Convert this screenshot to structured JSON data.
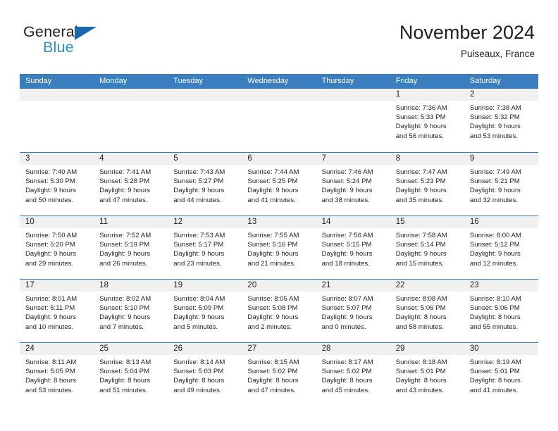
{
  "brand": {
    "name_top": "General",
    "name_bottom": "Blue",
    "accent_color": "#2b8fd6",
    "triangle_color": "#1b6ab0",
    "triangle_icon": "triangle-icon"
  },
  "header": {
    "title": "November 2024",
    "subtitle": "Puiseaux, France"
  },
  "calendar": {
    "header_bg": "#3a7ebf",
    "day_strip_bg": "#f0f0f0",
    "weekdays": [
      "Sunday",
      "Monday",
      "Tuesday",
      "Wednesday",
      "Thursday",
      "Friday",
      "Saturday"
    ],
    "weeks": [
      [
        {
          "date": "",
          "lines": []
        },
        {
          "date": "",
          "lines": []
        },
        {
          "date": "",
          "lines": []
        },
        {
          "date": "",
          "lines": []
        },
        {
          "date": "",
          "lines": []
        },
        {
          "date": "1",
          "lines": [
            "Sunrise: 7:36 AM",
            "Sunset: 5:33 PM",
            "Daylight: 9 hours",
            "and 56 minutes."
          ]
        },
        {
          "date": "2",
          "lines": [
            "Sunrise: 7:38 AM",
            "Sunset: 5:32 PM",
            "Daylight: 9 hours",
            "and 53 minutes."
          ]
        }
      ],
      [
        {
          "date": "3",
          "lines": [
            "Sunrise: 7:40 AM",
            "Sunset: 5:30 PM",
            "Daylight: 9 hours",
            "and 50 minutes."
          ]
        },
        {
          "date": "4",
          "lines": [
            "Sunrise: 7:41 AM",
            "Sunset: 5:28 PM",
            "Daylight: 9 hours",
            "and 47 minutes."
          ]
        },
        {
          "date": "5",
          "lines": [
            "Sunrise: 7:43 AM",
            "Sunset: 5:27 PM",
            "Daylight: 9 hours",
            "and 44 minutes."
          ]
        },
        {
          "date": "6",
          "lines": [
            "Sunrise: 7:44 AM",
            "Sunset: 5:25 PM",
            "Daylight: 9 hours",
            "and 41 minutes."
          ]
        },
        {
          "date": "7",
          "lines": [
            "Sunrise: 7:46 AM",
            "Sunset: 5:24 PM",
            "Daylight: 9 hours",
            "and 38 minutes."
          ]
        },
        {
          "date": "8",
          "lines": [
            "Sunrise: 7:47 AM",
            "Sunset: 5:23 PM",
            "Daylight: 9 hours",
            "and 35 minutes."
          ]
        },
        {
          "date": "9",
          "lines": [
            "Sunrise: 7:49 AM",
            "Sunset: 5:21 PM",
            "Daylight: 9 hours",
            "and 32 minutes."
          ]
        }
      ],
      [
        {
          "date": "10",
          "lines": [
            "Sunrise: 7:50 AM",
            "Sunset: 5:20 PM",
            "Daylight: 9 hours",
            "and 29 minutes."
          ]
        },
        {
          "date": "11",
          "lines": [
            "Sunrise: 7:52 AM",
            "Sunset: 5:19 PM",
            "Daylight: 9 hours",
            "and 26 minutes."
          ]
        },
        {
          "date": "12",
          "lines": [
            "Sunrise: 7:53 AM",
            "Sunset: 5:17 PM",
            "Daylight: 9 hours",
            "and 23 minutes."
          ]
        },
        {
          "date": "13",
          "lines": [
            "Sunrise: 7:55 AM",
            "Sunset: 5:16 PM",
            "Daylight: 9 hours",
            "and 21 minutes."
          ]
        },
        {
          "date": "14",
          "lines": [
            "Sunrise: 7:56 AM",
            "Sunset: 5:15 PM",
            "Daylight: 9 hours",
            "and 18 minutes."
          ]
        },
        {
          "date": "15",
          "lines": [
            "Sunrise: 7:58 AM",
            "Sunset: 5:14 PM",
            "Daylight: 9 hours",
            "and 15 minutes."
          ]
        },
        {
          "date": "16",
          "lines": [
            "Sunrise: 8:00 AM",
            "Sunset: 5:12 PM",
            "Daylight: 9 hours",
            "and 12 minutes."
          ]
        }
      ],
      [
        {
          "date": "17",
          "lines": [
            "Sunrise: 8:01 AM",
            "Sunset: 5:11 PM",
            "Daylight: 9 hours",
            "and 10 minutes."
          ]
        },
        {
          "date": "18",
          "lines": [
            "Sunrise: 8:02 AM",
            "Sunset: 5:10 PM",
            "Daylight: 9 hours",
            "and 7 minutes."
          ]
        },
        {
          "date": "19",
          "lines": [
            "Sunrise: 8:04 AM",
            "Sunset: 5:09 PM",
            "Daylight: 9 hours",
            "and 5 minutes."
          ]
        },
        {
          "date": "20",
          "lines": [
            "Sunrise: 8:05 AM",
            "Sunset: 5:08 PM",
            "Daylight: 9 hours",
            "and 2 minutes."
          ]
        },
        {
          "date": "21",
          "lines": [
            "Sunrise: 8:07 AM",
            "Sunset: 5:07 PM",
            "Daylight: 9 hours",
            "and 0 minutes."
          ]
        },
        {
          "date": "22",
          "lines": [
            "Sunrise: 8:08 AM",
            "Sunset: 5:06 PM",
            "Daylight: 8 hours",
            "and 58 minutes."
          ]
        },
        {
          "date": "23",
          "lines": [
            "Sunrise: 8:10 AM",
            "Sunset: 5:06 PM",
            "Daylight: 8 hours",
            "and 55 minutes."
          ]
        }
      ],
      [
        {
          "date": "24",
          "lines": [
            "Sunrise: 8:11 AM",
            "Sunset: 5:05 PM",
            "Daylight: 8 hours",
            "and 53 minutes."
          ]
        },
        {
          "date": "25",
          "lines": [
            "Sunrise: 8:13 AM",
            "Sunset: 5:04 PM",
            "Daylight: 8 hours",
            "and 51 minutes."
          ]
        },
        {
          "date": "26",
          "lines": [
            "Sunrise: 8:14 AM",
            "Sunset: 5:03 PM",
            "Daylight: 8 hours",
            "and 49 minutes."
          ]
        },
        {
          "date": "27",
          "lines": [
            "Sunrise: 8:15 AM",
            "Sunset: 5:02 PM",
            "Daylight: 8 hours",
            "and 47 minutes."
          ]
        },
        {
          "date": "28",
          "lines": [
            "Sunrise: 8:17 AM",
            "Sunset: 5:02 PM",
            "Daylight: 8 hours",
            "and 45 minutes."
          ]
        },
        {
          "date": "29",
          "lines": [
            "Sunrise: 8:18 AM",
            "Sunset: 5:01 PM",
            "Daylight: 8 hours",
            "and 43 minutes."
          ]
        },
        {
          "date": "30",
          "lines": [
            "Sunrise: 8:19 AM",
            "Sunset: 5:01 PM",
            "Daylight: 8 hours",
            "and 41 minutes."
          ]
        }
      ]
    ]
  }
}
